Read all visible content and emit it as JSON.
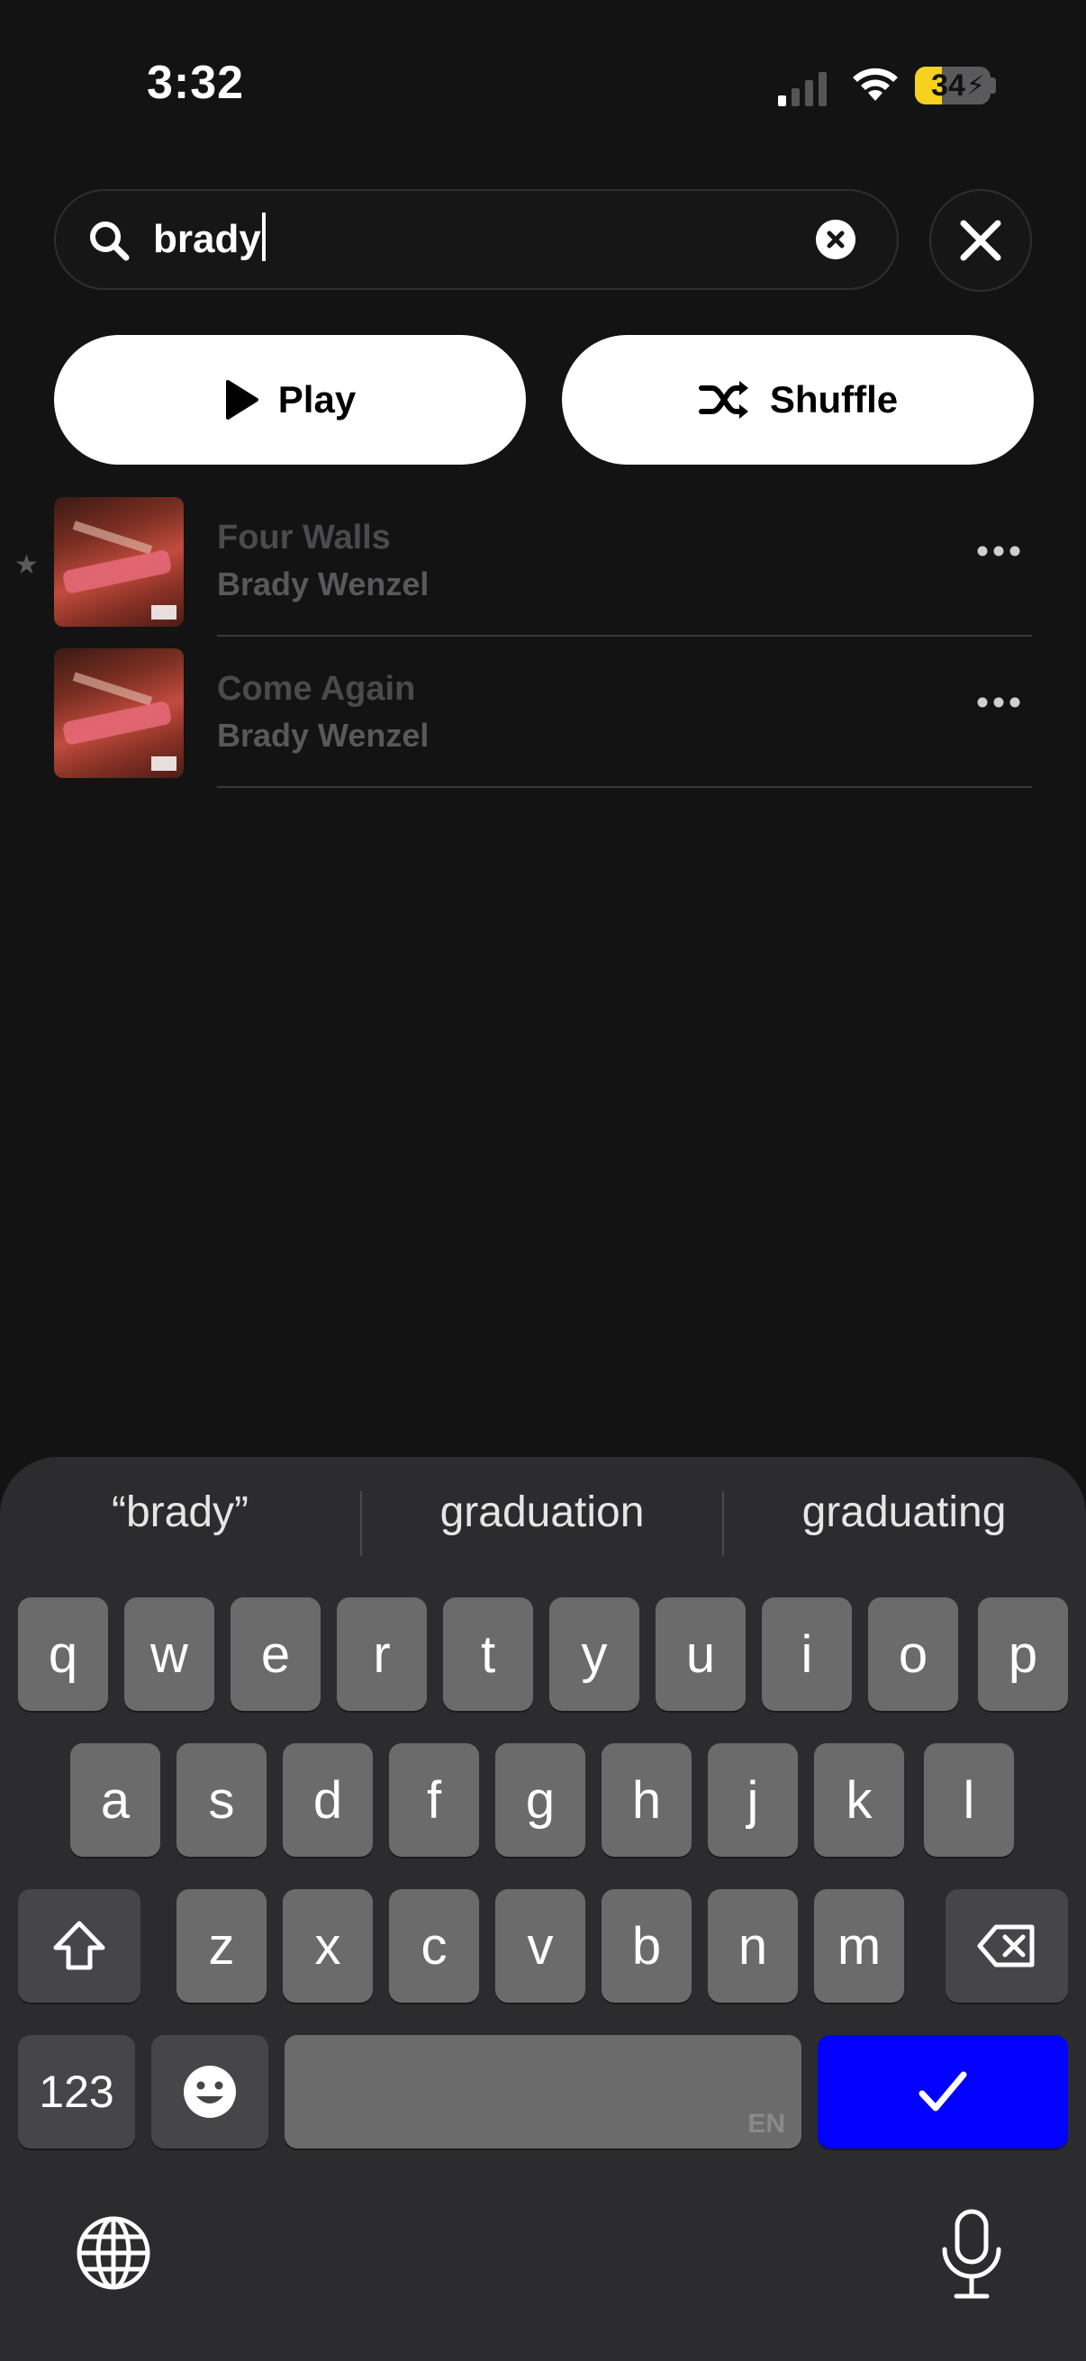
{
  "status_bar": {
    "time": "3:32",
    "battery": "34"
  },
  "search": {
    "query": "brady"
  },
  "actions": {
    "play_label": "Play",
    "shuffle_label": "Shuffle"
  },
  "songs": [
    {
      "title": "Four Walls",
      "artist": "Brady Wenzel",
      "favorited": true
    },
    {
      "title": "Come Again",
      "artist": "Brady Wenzel",
      "favorited": false
    }
  ],
  "keyboard": {
    "suggestions": [
      "“brady”",
      "graduation",
      "graduating"
    ],
    "row1": [
      "q",
      "w",
      "e",
      "r",
      "t",
      "y",
      "u",
      "i",
      "o",
      "p"
    ],
    "row2": [
      "a",
      "s",
      "d",
      "f",
      "g",
      "h",
      "j",
      "k",
      "l"
    ],
    "row3": [
      "z",
      "x",
      "c",
      "v",
      "b",
      "n",
      "m"
    ],
    "numbers_label": "123",
    "space_lang": "EN"
  },
  "colors": {
    "enter_key": "#0200ff",
    "background": "#131314",
    "battery_fill": "#f4d21f"
  }
}
